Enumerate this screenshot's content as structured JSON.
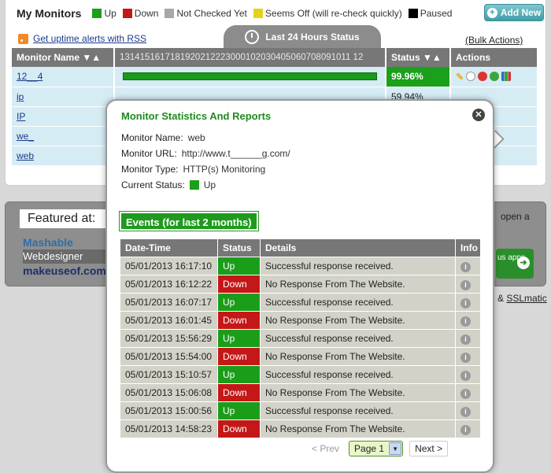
{
  "header": {
    "title": "My Monitors",
    "legend": [
      {
        "label": "Up",
        "color": "#1aa01a"
      },
      {
        "label": "Down",
        "color": "#c41818"
      },
      {
        "label": "Not Checked Yet",
        "color": "#a8a8a8"
      },
      {
        "label": "Seems Off (will re-check quickly)",
        "color": "#e6d21a"
      },
      {
        "label": "Paused",
        "color": "#000000"
      }
    ],
    "add_new_label": "Add New"
  },
  "toolbar": {
    "rss_label": "Get uptime alerts with RSS",
    "status24_label": "Last 24 Hours Status",
    "bulk_label": "(Bulk Actions)"
  },
  "monitors_table": {
    "headers": {
      "name": "Monitor Name",
      "hours": "1314151617181920212223000102030405060708091011 12",
      "status": "Status",
      "actions": "Actions"
    },
    "rows": [
      {
        "name": "12__4",
        "status": "99.96%"
      },
      {
        "name": "ip",
        "status": "59.94%"
      },
      {
        "name": "IP",
        "status": ""
      },
      {
        "name": "we_",
        "status": ""
      },
      {
        "name": "web",
        "status": ""
      }
    ]
  },
  "featured": {
    "label": "Featured at:",
    "logos": [
      "Mashable",
      "Webdesigner",
      "makeuseof.com"
    ]
  },
  "side": {
    "open_text": "open a",
    "apps_text": "us apps",
    "ssl_prefix": "&",
    "ssl_link": "SSLmatic"
  },
  "popup": {
    "title": "Monitor Statistics And Reports",
    "fields": [
      {
        "label": "Monitor Name:",
        "value": "web"
      },
      {
        "label": "Monitor URL:",
        "value": "http://www.t______g.com/"
      },
      {
        "label": "Monitor Type:",
        "value": "HTTP(s) Monitoring"
      },
      {
        "label": "Current Status:",
        "value": "Up"
      }
    ],
    "events_title": "Events (for last 2 months)",
    "events_headers": {
      "datetime": "Date-Time",
      "status": "Status",
      "details": "Details",
      "info": "Info"
    },
    "events": [
      {
        "datetime": "05/01/2013 16:17:10",
        "status": "Up",
        "details": "Successful response received."
      },
      {
        "datetime": "05/01/2013 16:12:22",
        "status": "Down",
        "details": "No Response From The Website."
      },
      {
        "datetime": "05/01/2013 16:07:17",
        "status": "Up",
        "details": "Successful response received."
      },
      {
        "datetime": "05/01/2013 16:01:45",
        "status": "Down",
        "details": "No Response From The Website."
      },
      {
        "datetime": "05/01/2013 15:56:29",
        "status": "Up",
        "details": "Successful response received."
      },
      {
        "datetime": "05/01/2013 15:54:00",
        "status": "Down",
        "details": "No Response From The Website."
      },
      {
        "datetime": "05/01/2013 15:10:57",
        "status": "Up",
        "details": "Successful response received."
      },
      {
        "datetime": "05/01/2013 15:06:08",
        "status": "Down",
        "details": "No Response From The Website."
      },
      {
        "datetime": "05/01/2013 15:00:56",
        "status": "Up",
        "details": "Successful response received."
      },
      {
        "datetime": "05/01/2013 14:58:23",
        "status": "Down",
        "details": "No Response From The Website."
      }
    ],
    "pager": {
      "prev": "< Prev",
      "page": "Page 1",
      "next": "Next >"
    }
  }
}
